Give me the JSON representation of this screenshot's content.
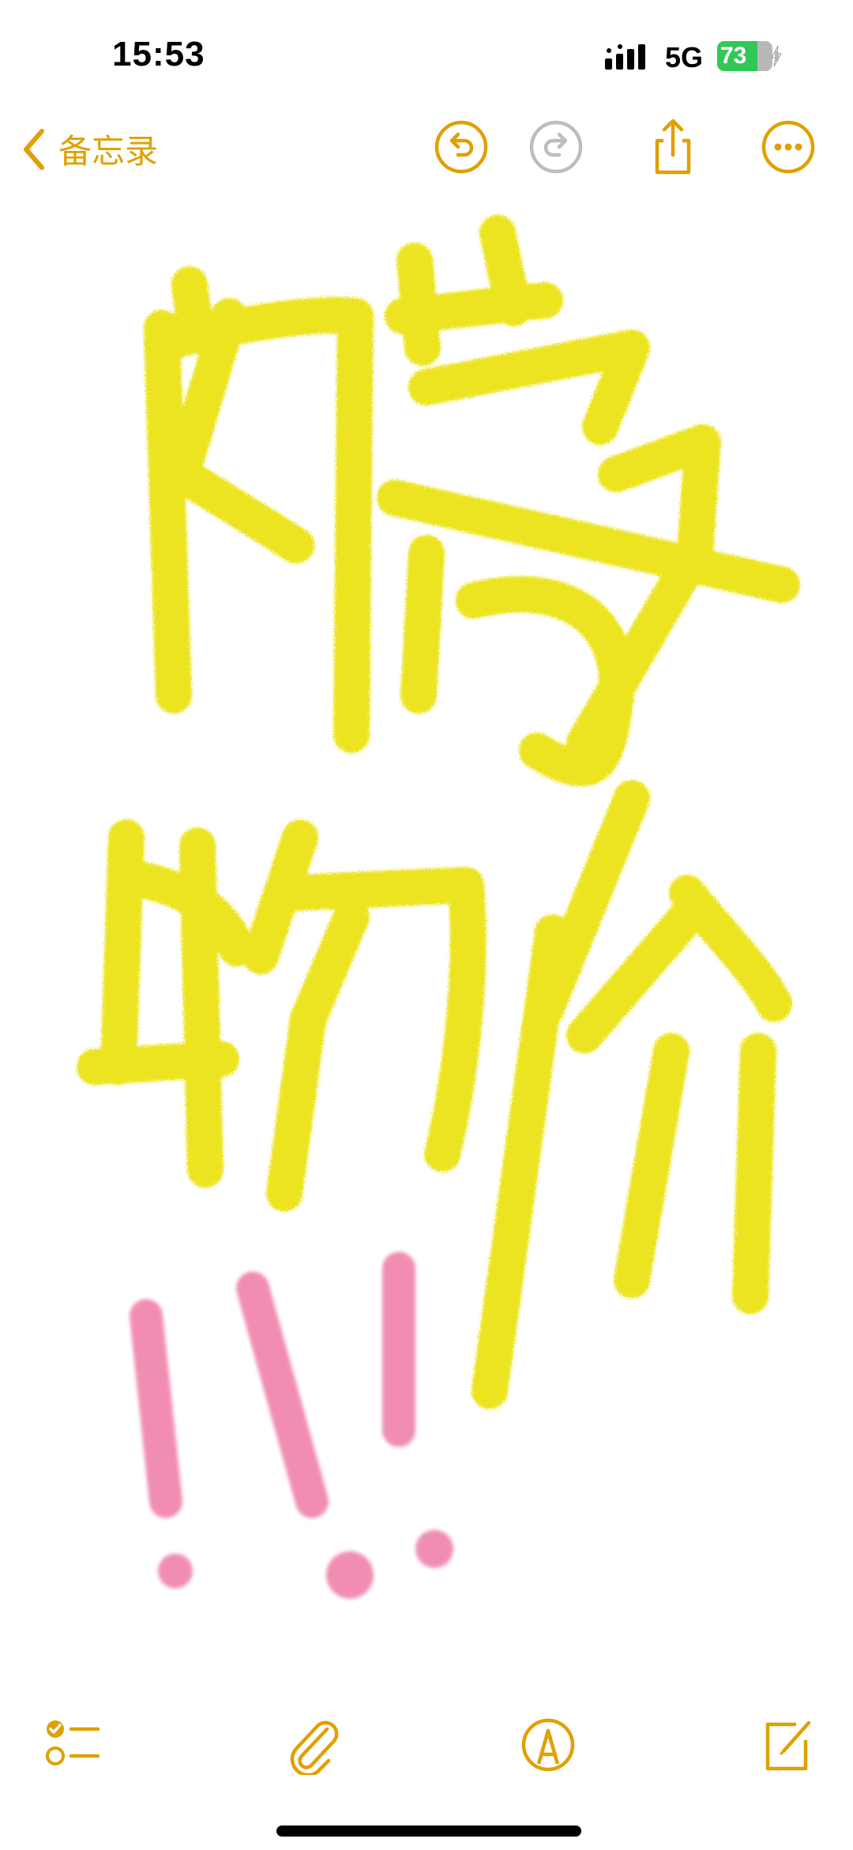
{
  "status_bar": {
    "time": "15:53",
    "network": "5G",
    "battery_percent": 73,
    "battery_label": "73"
  },
  "nav": {
    "back_label": "备忘录",
    "icons": [
      "chevron-left-icon",
      "undo-icon",
      "redo-icon",
      "share-icon",
      "more-icon"
    ]
  },
  "toolbar": {
    "icons": [
      "checklist-icon",
      "paperclip-icon",
      "markup-pen-icon",
      "compose-icon"
    ]
  },
  "colors": {
    "accent": "#e0a000",
    "disabled": "#bdbdbd",
    "ink_yellow": "#ece312",
    "ink_pink": "#ef7aa6",
    "battery_green": "#33c759"
  }
}
